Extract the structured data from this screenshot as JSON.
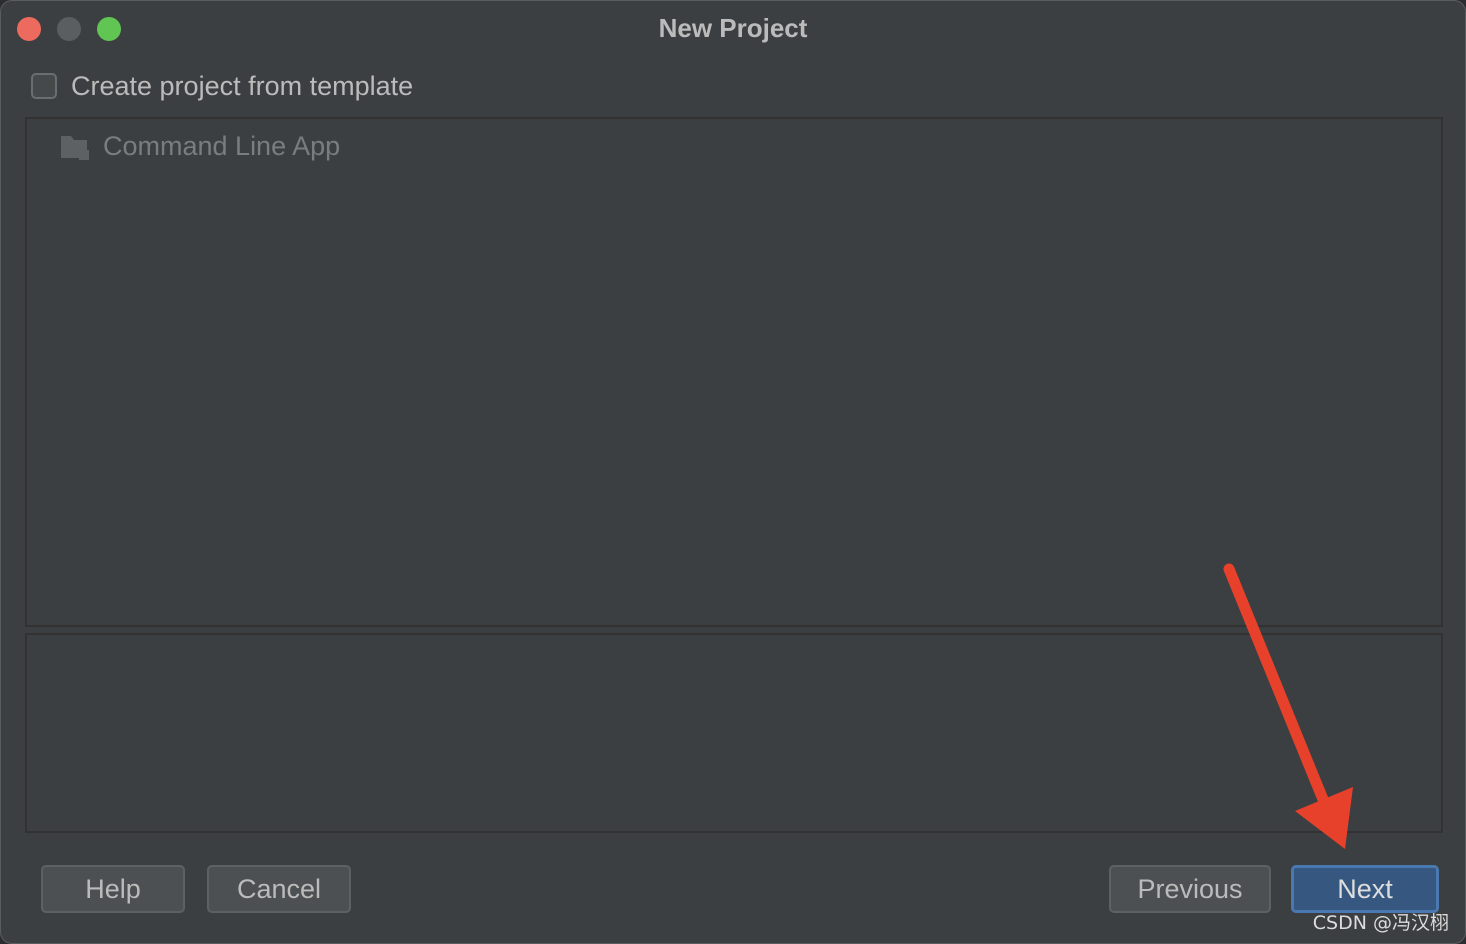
{
  "window": {
    "title": "New Project"
  },
  "template_option": {
    "checkbox_label": "Create project from template",
    "checked": false
  },
  "template_list": {
    "items": [
      {
        "label": "Command Line App",
        "icon": "folder-icon"
      }
    ]
  },
  "buttons": {
    "help": "Help",
    "cancel": "Cancel",
    "previous": "Previous",
    "next": "Next"
  },
  "colors": {
    "window_bg": "#3c3f41",
    "accent_button": "#365880",
    "annotation_arrow": "#e8412b",
    "close": "#ed6a5e",
    "maximize": "#61c554"
  },
  "watermark": "CSDN @冯汉栩"
}
